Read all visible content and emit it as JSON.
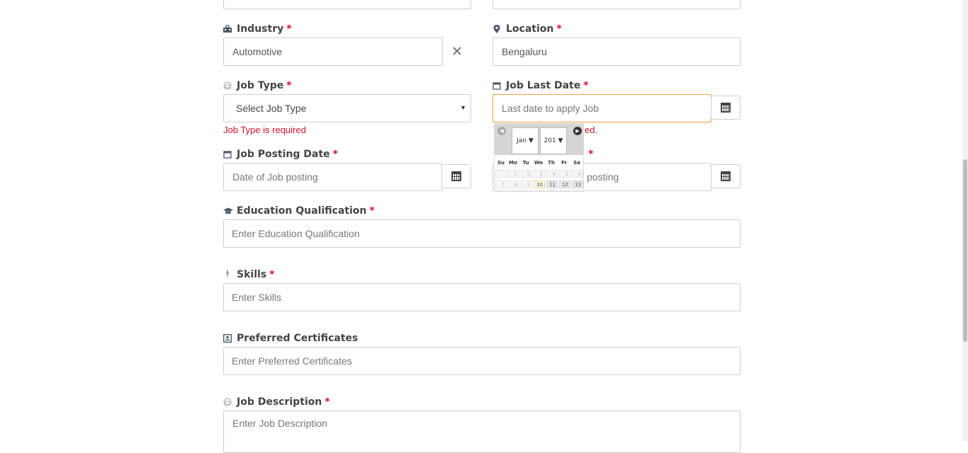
{
  "industry": {
    "label": "Industry",
    "value": "Automotive",
    "required": "*"
  },
  "location": {
    "label": "Location",
    "value": "Bengaluru",
    "required": "*"
  },
  "job_type": {
    "label": "Job Type",
    "selected": "Select Job Type",
    "required": "*",
    "error": "Job Type is required"
  },
  "job_last_date": {
    "label": "Job Last Date",
    "placeholder": "Last date to apply Job",
    "required": "*",
    "error_tail": "ed."
  },
  "job_posting_date": {
    "label": "Job Posting Date",
    "placeholder": "Date of Job posting",
    "required": "*"
  },
  "hidden_field": {
    "label_tail": "*",
    "placeholder_tail": "posting"
  },
  "education": {
    "label": "Education Qualification",
    "placeholder": "Enter Education Qualification",
    "required": "*"
  },
  "skills": {
    "label": "Skills",
    "placeholder": "Enter Skills",
    "required": "*"
  },
  "certificates": {
    "label": "Preferred Certificates",
    "placeholder": "Enter Preferred Certificates"
  },
  "job_description": {
    "label": "Job Description",
    "placeholder": "Enter Job Description",
    "required": "*"
  },
  "datepicker": {
    "month": "Jan",
    "year": "201",
    "weekdays": [
      "Su",
      "Mo",
      "Tu",
      "We",
      "Th",
      "Fr",
      "Sa"
    ],
    "week1": [
      "",
      "1",
      "2",
      "3",
      "4",
      "5",
      "6"
    ],
    "week2": [
      "7",
      "8",
      "9",
      "10",
      "11",
      "12",
      "13"
    ]
  },
  "colors": {
    "required": "#d0112b",
    "focus_border": "#e6a23c",
    "today_bg": "#fcf8e3"
  }
}
